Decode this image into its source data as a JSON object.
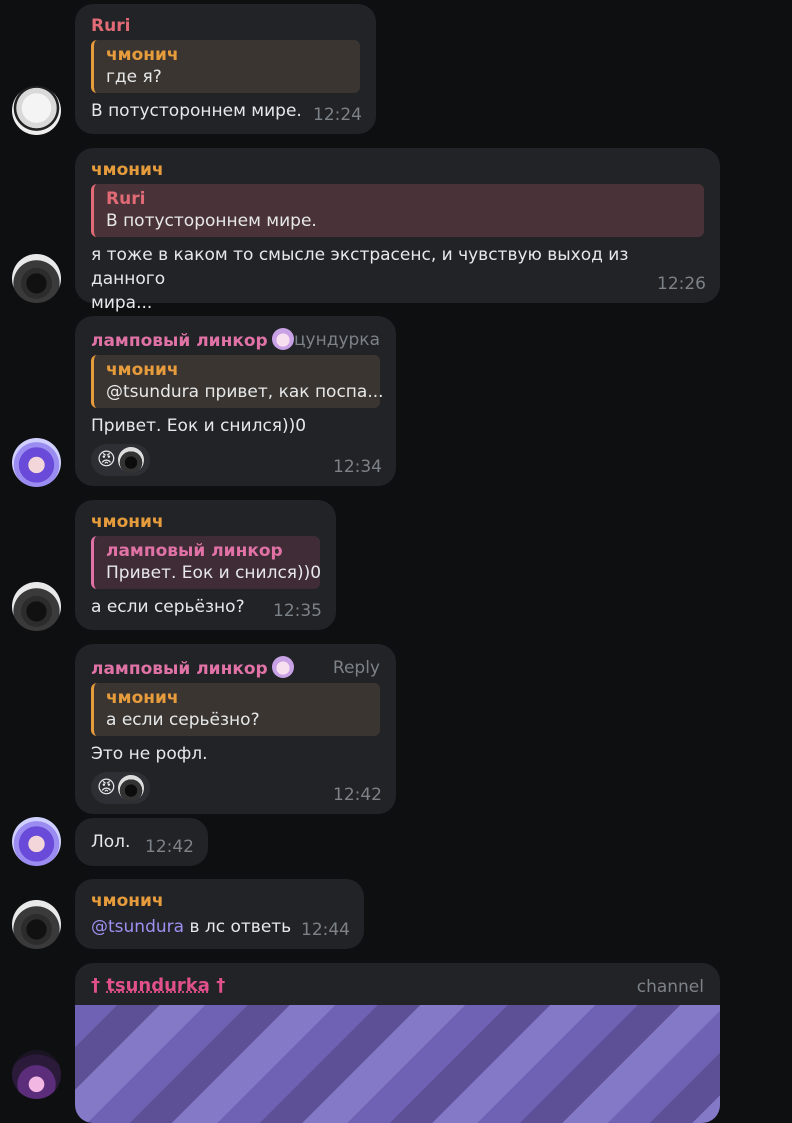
{
  "messages": {
    "m1": {
      "sender": "Ruri",
      "reply_name": "чмонич",
      "reply_text": "где я?",
      "text": "В потустороннем мире.",
      "time": "12:24"
    },
    "m2": {
      "sender": "чмонич",
      "reply_name": "Ruri",
      "reply_text": "В потустороннем мире.",
      "text_line1": "я тоже в каком то смысле экстрасенс, и чувствую выход из данного",
      "text_line2": "мира...",
      "time": "12:26"
    },
    "m3": {
      "sender": "ламповый линкор",
      "tag": "цундурка",
      "reply_name": "чмонич",
      "reply_text": "@tsundura привет, как поспа...",
      "text": "Привет. Еок и снился))0",
      "reaction_emoji": "😡",
      "time": "12:34"
    },
    "m4": {
      "sender": "чмонич",
      "reply_name": "ламповый линкор",
      "reply_text": "Привет. Еок и снился))0",
      "text": "а если серьёзно?",
      "time": "12:35"
    },
    "m5": {
      "sender": "ламповый линкор",
      "tag": "Reply",
      "reply_name": "чмонич",
      "reply_text": "а если серьёзно?",
      "text": "Это не рофл.",
      "reaction_emoji": "😡",
      "time": "12:42"
    },
    "m6": {
      "text": "Лол.",
      "time": "12:42"
    },
    "m7": {
      "sender": "чмонич",
      "mention": "@tsundura",
      "text": " в лс ответь",
      "time": "12:44"
    },
    "m8": {
      "cross_left": "† ",
      "sender": "tsundurka",
      "cross_right": " †",
      "tag": "channel"
    }
  },
  "colors": {
    "background": "#0e0f11",
    "bubble": "#212327",
    "orange": "#e69b3c",
    "red": "#e06a75",
    "pink": "#e072a6"
  }
}
